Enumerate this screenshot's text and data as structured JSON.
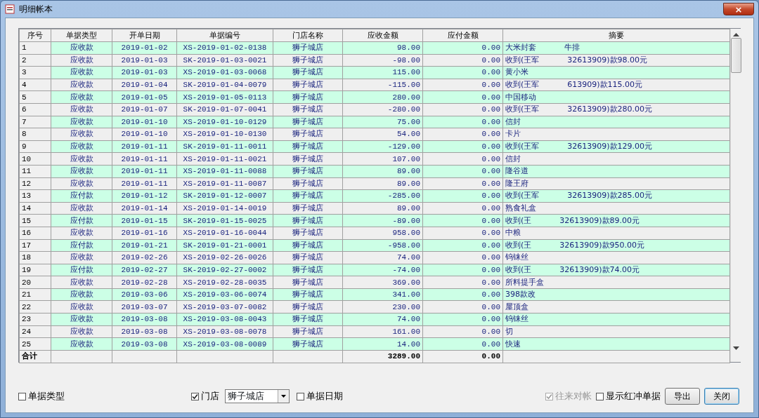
{
  "window": {
    "title": "明细帐本",
    "close_label": "×"
  },
  "table": {
    "columns": [
      "序号",
      "单据类型",
      "开单日期",
      "单据编号",
      "门店名称",
      "应收金额",
      "应付金额",
      "摘要"
    ],
    "rows": [
      {
        "seq": "1",
        "type": "应收款",
        "date": "2019-01-02",
        "number": "XS-2019-01-02-0138",
        "store": "狮子城店",
        "receivable": "98.00",
        "payable": "0.00",
        "summary": [
          "大米封套",
          "牛排"
        ]
      },
      {
        "seq": "2",
        "type": "应收款",
        "date": "2019-01-03",
        "number": "SK-2019-01-03-0021",
        "store": "狮子城店",
        "receivable": "-98.00",
        "payable": "0.00",
        "summary": [
          "收到(王军",
          "32613909)款98.00元"
        ]
      },
      {
        "seq": "3",
        "type": "应收款",
        "date": "2019-01-03",
        "number": "XS-2019-01-03-0068",
        "store": "狮子城店",
        "receivable": "115.00",
        "payable": "0.00",
        "summary": [
          "黄小米"
        ]
      },
      {
        "seq": "4",
        "type": "应收款",
        "date": "2019-01-04",
        "number": "SK-2019-01-04-0079",
        "store": "狮子城店",
        "receivable": "-115.00",
        "payable": "0.00",
        "summary": [
          "收到(王军",
          "613909)款115.00元"
        ]
      },
      {
        "seq": "5",
        "type": "应收款",
        "date": "2019-01-05",
        "number": "XS-2019-01-05-0113",
        "store": "狮子城店",
        "receivable": "280.00",
        "payable": "0.00",
        "summary": [
          "中国移动"
        ]
      },
      {
        "seq": "6",
        "type": "应收款",
        "date": "2019-01-07",
        "number": "SK-2019-01-07-0041",
        "store": "狮子城店",
        "receivable": "-280.00",
        "payable": "0.00",
        "summary": [
          "收到(王军",
          "32613909)款280.00元"
        ]
      },
      {
        "seq": "7",
        "type": "应收款",
        "date": "2019-01-10",
        "number": "XS-2019-01-10-0129",
        "store": "狮子城店",
        "receivable": "75.00",
        "payable": "0.00",
        "summary": [
          "信封"
        ]
      },
      {
        "seq": "8",
        "type": "应收款",
        "date": "2019-01-10",
        "number": "XS-2019-01-10-0130",
        "store": "狮子城店",
        "receivable": "54.00",
        "payable": "0.00",
        "summary": [
          "卡片"
        ]
      },
      {
        "seq": "9",
        "type": "应收款",
        "date": "2019-01-11",
        "number": "SK-2019-01-11-0011",
        "store": "狮子城店",
        "receivable": "-129.00",
        "payable": "0.00",
        "summary": [
          "收到(王军",
          "32613909)款129.00元"
        ]
      },
      {
        "seq": "10",
        "type": "应收款",
        "date": "2019-01-11",
        "number": "XS-2019-01-11-0021",
        "store": "狮子城店",
        "receivable": "107.00",
        "payable": "0.00",
        "summary": [
          "信封"
        ]
      },
      {
        "seq": "11",
        "type": "应收款",
        "date": "2019-01-11",
        "number": "XS-2019-01-11-0088",
        "store": "狮子城店",
        "receivable": "89.00",
        "payable": "0.00",
        "summary": [
          "隆谷道"
        ]
      },
      {
        "seq": "12",
        "type": "应收款",
        "date": "2019-01-11",
        "number": "XS-2019-01-11-0087",
        "store": "狮子城店",
        "receivable": "89.00",
        "payable": "0.00",
        "summary": [
          "隆王府"
        ]
      },
      {
        "seq": "13",
        "type": "应付款",
        "date": "2019-01-12",
        "number": "SK-2019-01-12-0007",
        "store": "狮子城店",
        "receivable": "-285.00",
        "payable": "0.00",
        "summary": [
          "收到(王军",
          "32613909)款285.00元"
        ]
      },
      {
        "seq": "14",
        "type": "应收款",
        "date": "2019-01-14",
        "number": "XS-2019-01-14-0019",
        "store": "狮子城店",
        "receivable": "89.00",
        "payable": "0.00",
        "summary": [
          "熟食礼盒"
        ]
      },
      {
        "seq": "15",
        "type": "应付款",
        "date": "2019-01-15",
        "number": "SK-2019-01-15-0025",
        "store": "狮子城店",
        "receivable": "-89.00",
        "payable": "0.00",
        "summary": [
          "收到(王",
          "32613909)款89.00元"
        ]
      },
      {
        "seq": "16",
        "type": "应收款",
        "date": "2019-01-16",
        "number": "XS-2019-01-16-0044",
        "store": "狮子城店",
        "receivable": "958.00",
        "payable": "0.00",
        "summary": [
          "中粮"
        ]
      },
      {
        "seq": "17",
        "type": "应付款",
        "date": "2019-01-21",
        "number": "SK-2019-01-21-0001",
        "store": "狮子城店",
        "receivable": "-958.00",
        "payable": "0.00",
        "summary": [
          "收到(王",
          "32613909)款950.00元"
        ]
      },
      {
        "seq": "18",
        "type": "应收款",
        "date": "2019-02-26",
        "number": "XS-2019-02-26-0026",
        "store": "狮子城店",
        "receivable": "74.00",
        "payable": "0.00",
        "summary": [
          "钨铼丝"
        ]
      },
      {
        "seq": "19",
        "type": "应付款",
        "date": "2019-02-27",
        "number": "SK-2019-02-27-0002",
        "store": "狮子城店",
        "receivable": "-74.00",
        "payable": "0.00",
        "summary": [
          "收到(王",
          "32613909)款74.00元"
        ]
      },
      {
        "seq": "20",
        "type": "应收款",
        "date": "2019-02-28",
        "number": "XS-2019-02-28-0035",
        "store": "狮子城店",
        "receivable": "369.00",
        "payable": "0.00",
        "summary": [
          "所料提手盒"
        ]
      },
      {
        "seq": "21",
        "type": "应收款",
        "date": "2019-03-06",
        "number": "XS-2019-03-06-0074",
        "store": "狮子城店",
        "receivable": "341.00",
        "payable": "0.00",
        "summary": [
          "398款改"
        ]
      },
      {
        "seq": "22",
        "type": "应收款",
        "date": "2019-03-07",
        "number": "XS-2019-03-07-0082",
        "store": "狮子城店",
        "receivable": "230.00",
        "payable": "0.00",
        "summary": [
          "屋顶盒"
        ]
      },
      {
        "seq": "23",
        "type": "应收款",
        "date": "2019-03-08",
        "number": "XS-2019-03-08-0043",
        "store": "狮子城店",
        "receivable": "74.00",
        "payable": "0.00",
        "summary": [
          "钨铼丝"
        ]
      },
      {
        "seq": "24",
        "type": "应收款",
        "date": "2019-03-08",
        "number": "XS-2019-03-08-0078",
        "store": "狮子城店",
        "receivable": "161.00",
        "payable": "0.00",
        "summary": [
          "切"
        ]
      },
      {
        "seq": "25",
        "type": "应收款",
        "date": "2019-03-08",
        "number": "XS-2019-03-08-0089",
        "store": "狮子城店",
        "receivable": "14.00",
        "payable": "0.00",
        "summary": [
          "快速"
        ]
      }
    ],
    "total": {
      "label": "合计",
      "receivable": "3289.00",
      "payable": "0.00"
    }
  },
  "footer": {
    "left": [
      {
        "kind": "checkbox",
        "label": "单据类型",
        "checked": false,
        "disabled": false
      },
      {
        "kind": "checkbox",
        "label": "门店",
        "checked": true,
        "disabled": false
      },
      {
        "kind": "select",
        "value": "狮子城店"
      },
      {
        "kind": "checkbox",
        "label": "单据日期",
        "checked": false,
        "disabled": false
      }
    ],
    "right": [
      {
        "kind": "checkbox",
        "label": "往来对帐",
        "checked": true,
        "disabled": true
      },
      {
        "kind": "checkbox",
        "label": "显示红冲单据",
        "checked": false,
        "disabled": false
      },
      {
        "kind": "button",
        "label": "导出",
        "focused": false
      },
      {
        "kind": "button",
        "label": "关闭",
        "focused": true
      }
    ]
  }
}
